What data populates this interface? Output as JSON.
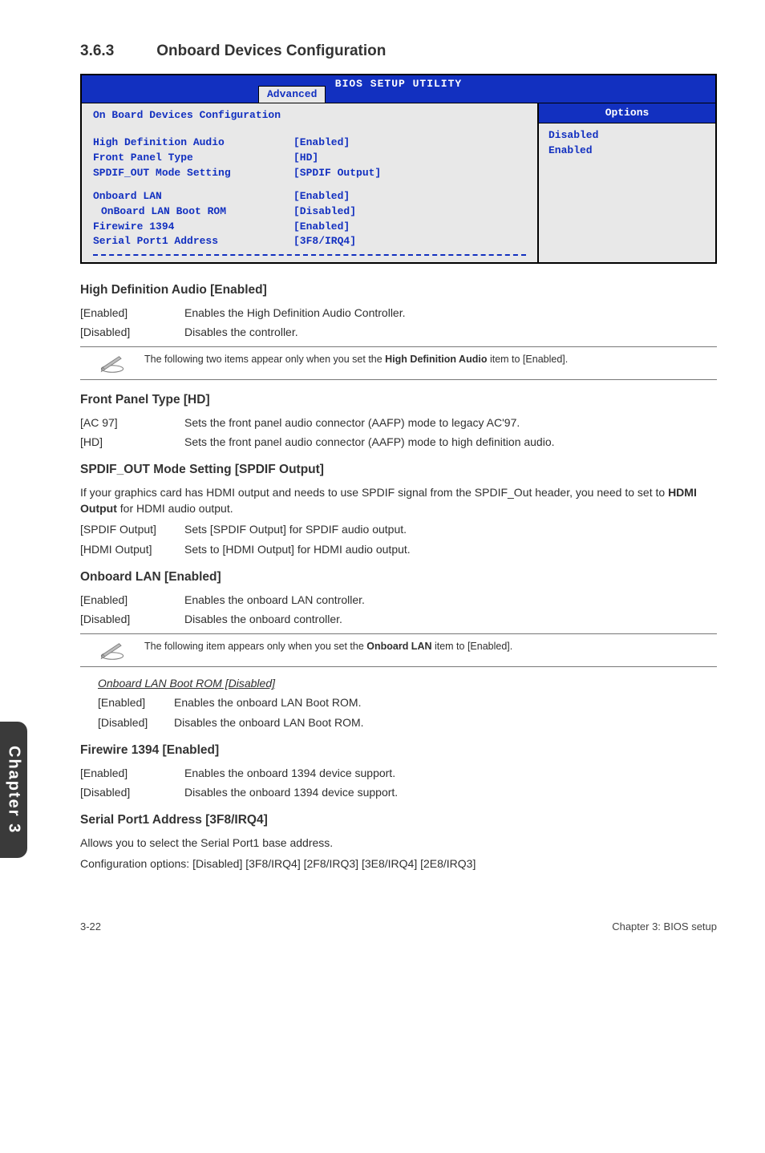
{
  "section": {
    "number": "3.6.3",
    "title": "Onboard Devices Configuration"
  },
  "bios": {
    "title": "BIOS SETUP UTILITY",
    "tab": "Advanced",
    "panel_heading": "On Board Devices Configuration",
    "rows1": [
      {
        "k": "High Definition Audio",
        "v": "[Enabled]"
      },
      {
        "k": "Front Panel Type",
        "v": "[HD]"
      },
      {
        "k": "SPDIF_OUT Mode Setting",
        "v": "[SPDIF Output]"
      }
    ],
    "rows2": [
      {
        "k": "Onboard LAN",
        "v": "[Enabled]",
        "sub": false
      },
      {
        "k": "OnBoard LAN Boot ROM",
        "v": "[Disabled]",
        "sub": true
      },
      {
        "k": "Firewire 1394",
        "v": "[Enabled]",
        "sub": false
      },
      {
        "k": "Serial Port1 Address",
        "v": "[3F8/IRQ4]",
        "sub": false
      }
    ],
    "options_head": "Options",
    "options": [
      "Disabled",
      "Enabled"
    ]
  },
  "hda": {
    "title": "High Definition Audio [Enabled]",
    "lines": [
      {
        "k": "[Enabled]",
        "v": "Enables the High Definition Audio Controller."
      },
      {
        "k": "[Disabled]",
        "v": "Disables the controller."
      }
    ],
    "note_prefix": "The following two items appear only when you set the ",
    "note_bold": "High Definition Audio",
    "note_suffix": " item to [Enabled]."
  },
  "fpt": {
    "title": "Front Panel Type [HD]",
    "lines": [
      {
        "k": "[AC 97]",
        "v": "Sets the front panel audio connector (AAFP) mode to legacy AC'97."
      },
      {
        "k": "[HD]",
        "v": "Sets the front panel audio connector (AAFP) mode to high definition audio."
      }
    ]
  },
  "spdif": {
    "title": "SPDIF_OUT Mode Setting [SPDIF Output]",
    "para_prefix": "If your graphics card has HDMI output and needs to use SPDIF signal from the SPDIF_Out header, you need to set to ",
    "para_bold": "HDMI Output",
    "para_suffix": " for HDMI audio output.",
    "lines": [
      {
        "k": "[SPDIF Output]",
        "v": "Sets [SPDIF Output] for SPDIF audio output."
      },
      {
        "k": "[HDMI Output]",
        "v": "Sets to [HDMI Output] for HDMI audio output."
      }
    ]
  },
  "olan": {
    "title": "Onboard LAN [Enabled]",
    "lines": [
      {
        "k": "[Enabled]",
        "v": "Enables the onboard LAN controller."
      },
      {
        "k": "[Disabled]",
        "v": "Disables the onboard controller."
      }
    ],
    "note_prefix": "The following item appears only when you set the ",
    "note_bold": "Onboard LAN",
    "note_suffix": " item to [Enabled].",
    "sub_title": "Onboard LAN Boot ROM [Disabled]",
    "sub_lines": [
      {
        "k": "[Enabled]",
        "v": "Enables the onboard LAN Boot ROM."
      },
      {
        "k": "[Disabled]",
        "v": "Disables the onboard LAN Boot ROM."
      }
    ]
  },
  "fw": {
    "title": "Firewire 1394 [Enabled]",
    "lines": [
      {
        "k": "[Enabled]",
        "v": "Enables the onboard 1394 device support."
      },
      {
        "k": "[Disabled]",
        "v": "Disables the onboard 1394 device support."
      }
    ]
  },
  "sp": {
    "title": "Serial Port1 Address [3F8/IRQ4]",
    "line1": "Allows you to select the Serial Port1 base address.",
    "line2": "Configuration options: [Disabled] [3F8/IRQ4] [2F8/IRQ3] [3E8/IRQ4] [2E8/IRQ3]"
  },
  "side_tab": "Chapter 3",
  "footer": {
    "left": "3-22",
    "right": "Chapter 3: BIOS setup"
  }
}
